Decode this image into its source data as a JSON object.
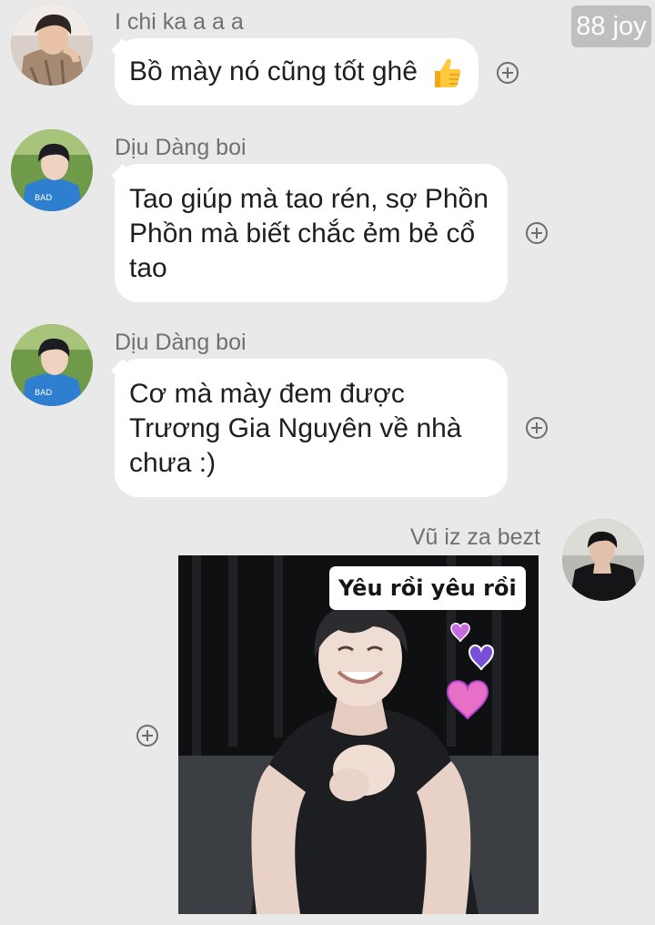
{
  "watermark": "88 joy",
  "messages": [
    {
      "sender": "I chi ka a a a",
      "text": "Bồ mày nó cũng tốt ghê",
      "emoji": "👍"
    },
    {
      "sender": "Dịu Dàng boi",
      "lines": [
        "Tao giúp mà tao rén, sợ Phồn",
        "Phồn mà biết chắc ẻm bẻ cổ",
        "tao"
      ]
    },
    {
      "sender": "Dịu Dàng boi",
      "lines": [
        "Cơ mà mày đem được",
        "Trương Gia Nguyên về nhà",
        "chưa :)"
      ]
    },
    {
      "sender": "Vũ iz za bezt",
      "sticker_caption": "Yêu rồi yêu rồi"
    }
  ],
  "icons": {
    "react": "add-reaction-icon",
    "like": "thumbs-up-icon",
    "hearts": "heart-icon"
  },
  "colors": {
    "background": "#e9e9e9",
    "bubble": "#ffffff",
    "sender_text": "#707070",
    "heart": "#e86fc8"
  }
}
